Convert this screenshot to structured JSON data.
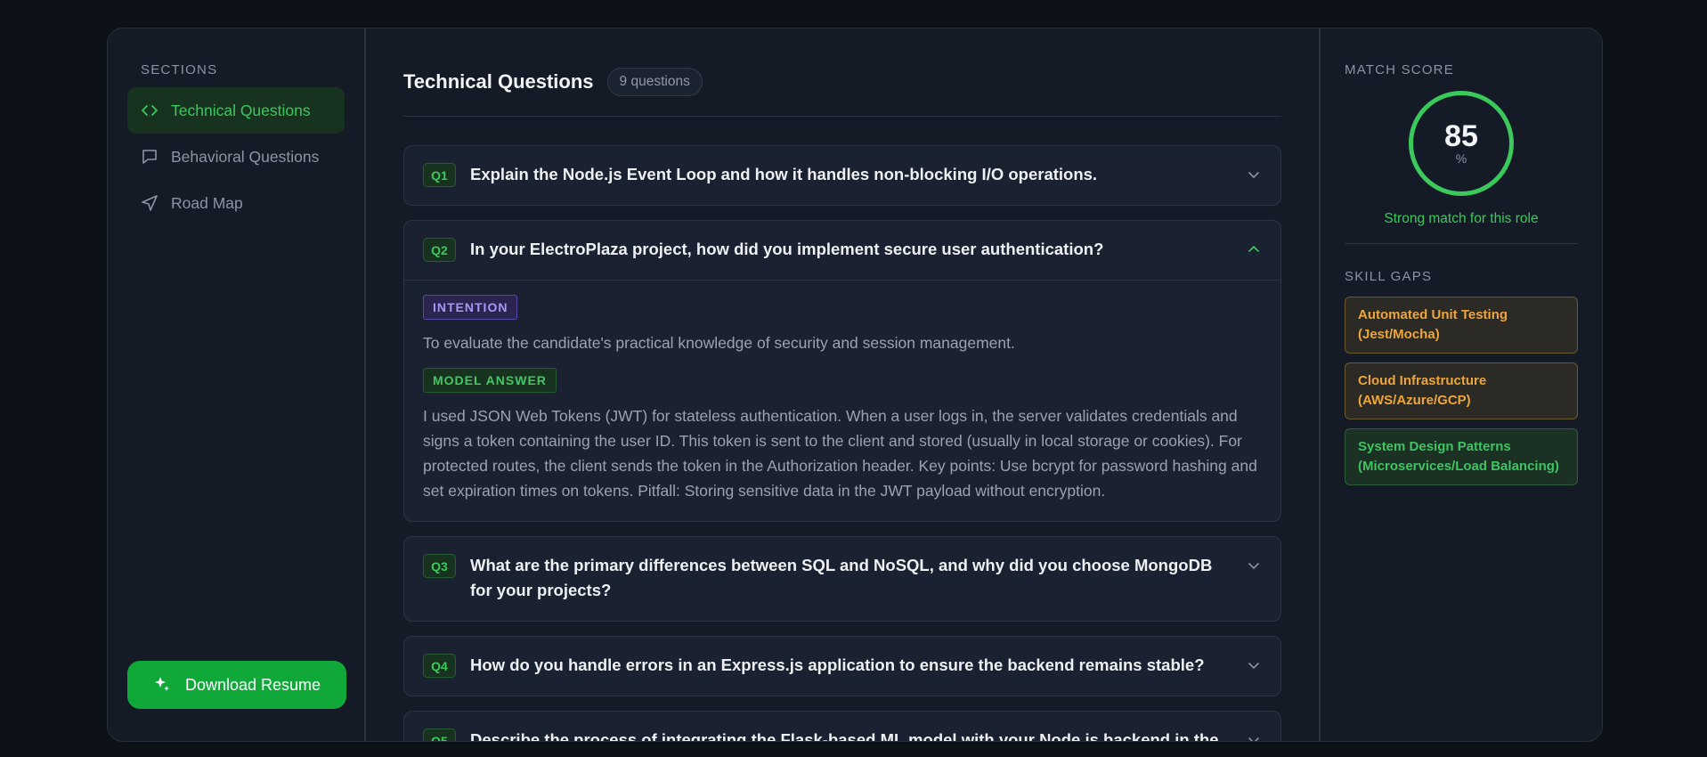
{
  "sidebar": {
    "title": "SECTIONS",
    "items": [
      {
        "label": "Technical Questions",
        "icon": "code-icon",
        "active": true
      },
      {
        "label": "Behavioral Questions",
        "icon": "message-icon",
        "active": false
      },
      {
        "label": "Road Map",
        "icon": "navigation-icon",
        "active": false
      }
    ],
    "download_label": "Download Resume"
  },
  "main": {
    "title": "Technical Questions",
    "count": "9 questions",
    "questions": [
      {
        "id": "Q1",
        "text": "Explain the Node.js Event Loop and how it handles non-blocking I/O operations.",
        "expanded": false
      },
      {
        "id": "Q2",
        "text": "In your ElectroPlaza project, how did you implement secure user authentication?",
        "expanded": true,
        "intention_label": "INTENTION",
        "intention": "To evaluate the candidate's practical knowledge of security and session management.",
        "answer_label": "MODEL ANSWER",
        "answer": "I used JSON Web Tokens (JWT) for stateless authentication. When a user logs in, the server validates credentials and signs a token containing the user ID. This token is sent to the client and stored (usually in local storage or cookies). For protected routes, the client sends the token in the Authorization header. Key points: Use bcrypt for password hashing and set expiration times on tokens. Pitfall: Storing sensitive data in the JWT payload without encryption."
      },
      {
        "id": "Q3",
        "text": "What are the primary differences between SQL and NoSQL, and why did you choose MongoDB for your projects?",
        "expanded": false
      },
      {
        "id": "Q4",
        "text": "How do you handle errors in an Express.js application to ensure the backend remains stable?",
        "expanded": false
      },
      {
        "id": "Q5",
        "text": "Describe the process of integrating the Flask-based ML model with your Node.js backend in the",
        "expanded": false
      }
    ]
  },
  "right": {
    "score_title": "MATCH SCORE",
    "score": "85",
    "score_unit": "%",
    "score_note": "Strong match for this role",
    "gaps_title": "SKILL GAPS",
    "gaps": [
      {
        "label": "Automated Unit Testing (Jest/Mocha)",
        "color": "orange"
      },
      {
        "label": "Cloud Infrastructure (AWS/Azure/GCP)",
        "color": "orange"
      },
      {
        "label": "System Design Patterns (Microservices/Load Balancing)",
        "color": "green"
      }
    ]
  },
  "colors": {
    "accent": "#3bc95c",
    "button": "#11a83a",
    "warning": "#efa53a",
    "intention": "#a995f6"
  }
}
